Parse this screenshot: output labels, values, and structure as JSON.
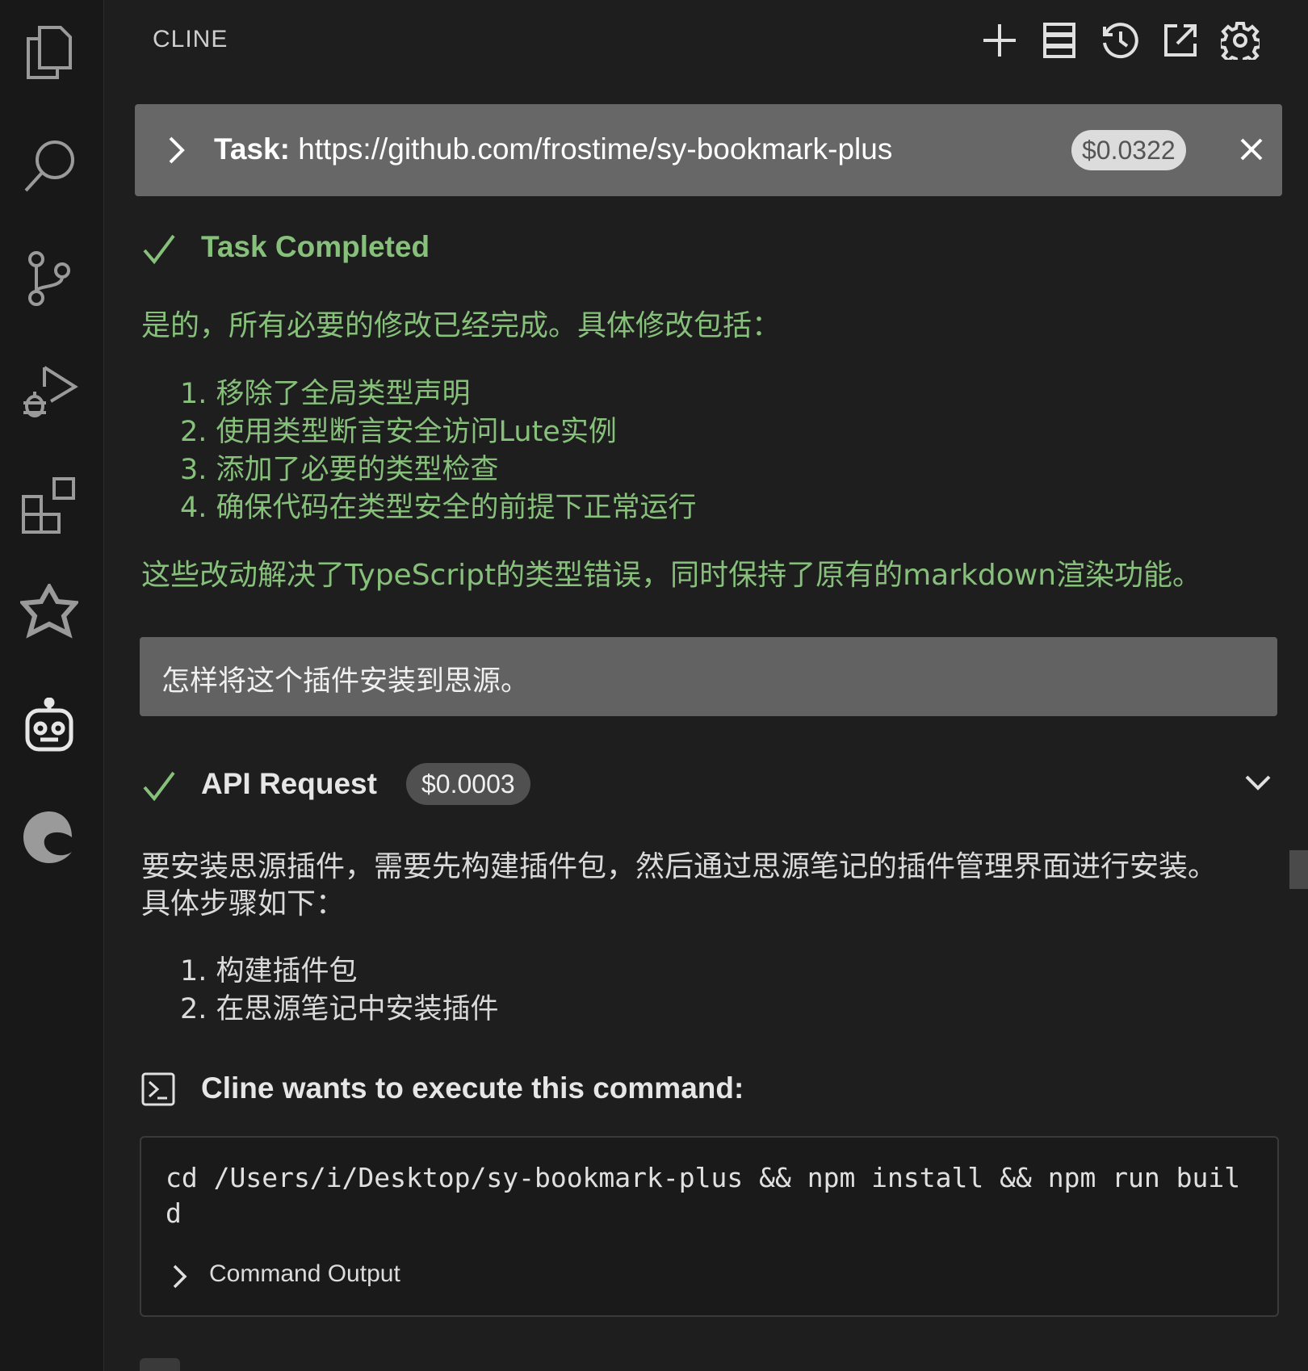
{
  "activity_bar": {
    "icons": [
      "files-icon",
      "search-icon",
      "source-control-icon",
      "run-debug-icon",
      "extensions-icon",
      "gemini-icon",
      "cline-robot-icon",
      "edge-icon"
    ]
  },
  "header": {
    "title": "CLINE",
    "buttons": [
      "plus-icon",
      "mcp-servers-icon",
      "history-icon",
      "open-in-editor-icon",
      "gear-icon"
    ]
  },
  "task": {
    "label": "Task:",
    "url": "https://github.com/frostime/sy-bookmark-plus",
    "cost": "$0.0322"
  },
  "completion": {
    "title": "Task Completed",
    "intro": "是的，所有必要的修改已经完成。具体修改包括：",
    "items": [
      "1. 移除了全局类型声明",
      "2. 使用类型断言安全访问Lute实例",
      "3. 添加了必要的类型检查",
      "4. 确保代码在类型安全的前提下正常运行"
    ],
    "summary": "这些改动解决了TypeScript的类型错误，同时保持了原有的markdown渲染功能。"
  },
  "user_message": "怎样将这个插件安装到思源。",
  "api_request": {
    "title": "API Request",
    "cost": "$0.0003"
  },
  "response": {
    "line1": "要安装思源插件，需要先构建插件包，然后通过思源笔记的插件管理界面进行安装。",
    "line2": "具体步骤如下：",
    "items": [
      "1. 构建插件包",
      "2. 在思源笔记中安装插件"
    ]
  },
  "command": {
    "title": "Cline wants to execute this command:",
    "code": "cd /Users/i/Desktop/sy-bookmark-plus && npm install && npm run build",
    "output_label": "Command Output"
  },
  "colors": {
    "accent_green": "#86c07a",
    "background": "#1e1e1e",
    "task_bar": "#676767"
  }
}
